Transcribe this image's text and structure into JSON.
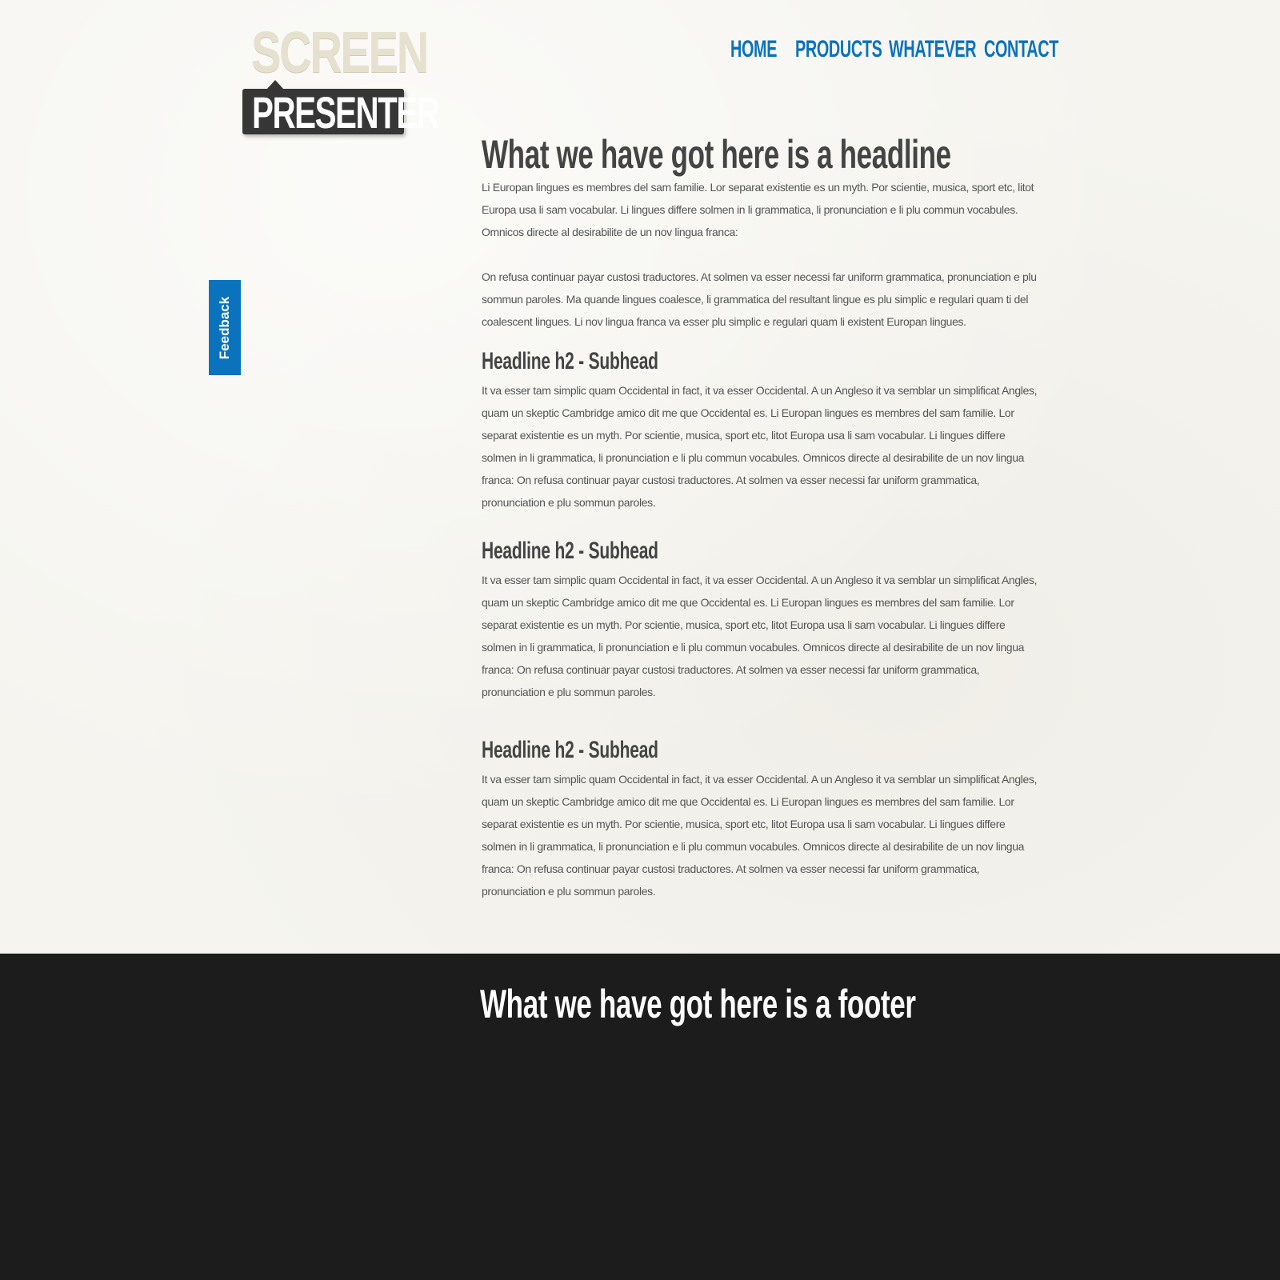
{
  "logo": {
    "top_text": "SCREEN",
    "bottom_text": "PRESENTER",
    "colors": {
      "top": "#e6e1cf",
      "box": "#363636"
    }
  },
  "nav": {
    "items": [
      {
        "label": "HOME"
      },
      {
        "label": "PRODUCTS"
      },
      {
        "label": "WHATEVER"
      },
      {
        "label": "CONTACT"
      }
    ],
    "color": "#0b72bd"
  },
  "feedback": {
    "label": "Feedback",
    "color": "#0b72bd"
  },
  "main": {
    "headline": "What we have got here is a headline",
    "intro_paragraphs": [
      "Li Europan lingues es membres del sam familie. Lor separat existentie es un myth. Por scientie, musica, sport etc, litot Europa usa li sam vocabular. Li lingues differe solmen in li grammatica, li pronunciation e li plu commun vocabules. Omnicos directe al desirabilite de un nov lingua franca:",
      "On refusa continuar payar custosi traductores. At solmen va esser necessi far uniform grammatica, pronunciation e plu sommun paroles. Ma quande lingues coalesce, li grammatica del resultant lingue es plu simplic e regulari quam ti del coalescent lingues. Li nov lingua franca va esser plu simplic e regulari quam li existent Europan lingues."
    ],
    "sections": [
      {
        "subhead": "Headline h2 - Subhead",
        "body": "It va esser tam simplic quam Occidental in fact, it va esser Occidental. A un Angleso it va semblar un simplificat Angles, quam un skeptic Cambridge amico dit me que Occidental es. Li Europan lingues es membres del sam familie. Lor separat existentie es un myth. Por scientie, musica, sport etc, litot Europa usa li sam vocabular. Li lingues differe solmen in li grammatica, li pronunciation e li plu commun vocabules. Omnicos directe al desirabilite de un nov lingua franca: On refusa continuar payar custosi traductores. At solmen va esser necessi far uniform grammatica, pronunciation e plu sommun paroles."
      },
      {
        "subhead": "Headline h2 - Subhead",
        "body": "It va esser tam simplic quam Occidental in fact, it va esser Occidental. A un Angleso it va semblar un simplificat Angles, quam un skeptic Cambridge amico dit me que Occidental es. Li Europan lingues es membres del sam familie. Lor separat existentie es un myth. Por scientie, musica, sport etc, litot Europa usa li sam vocabular. Li lingues differe solmen in li grammatica, li pronunciation e li plu commun vocabules. Omnicos directe al desirabilite de un nov lingua franca: On refusa continuar payar custosi traductores. At solmen va esser necessi far uniform grammatica, pronunciation e plu sommun paroles."
      },
      {
        "subhead": "Headline h2 - Subhead",
        "body": "It va esser tam simplic quam Occidental in fact, it va esser Occidental. A un Angleso it va semblar un simplificat Angles, quam un skeptic Cambridge amico dit me que Occidental es. Li Europan lingues es membres del sam familie. Lor separat existentie es un myth. Por scientie, musica, sport etc, litot Europa usa li sam vocabular. Li lingues differe solmen in li grammatica, li pronunciation e li plu commun vocabules. Omnicos directe al desirabilite de un nov lingua franca: On refusa continuar payar custosi traductores. At solmen va esser necessi far uniform grammatica, pronunciation e plu sommun paroles."
      }
    ]
  },
  "footer": {
    "title": "What we have got here is a footer",
    "color": "#1c1c1c"
  }
}
